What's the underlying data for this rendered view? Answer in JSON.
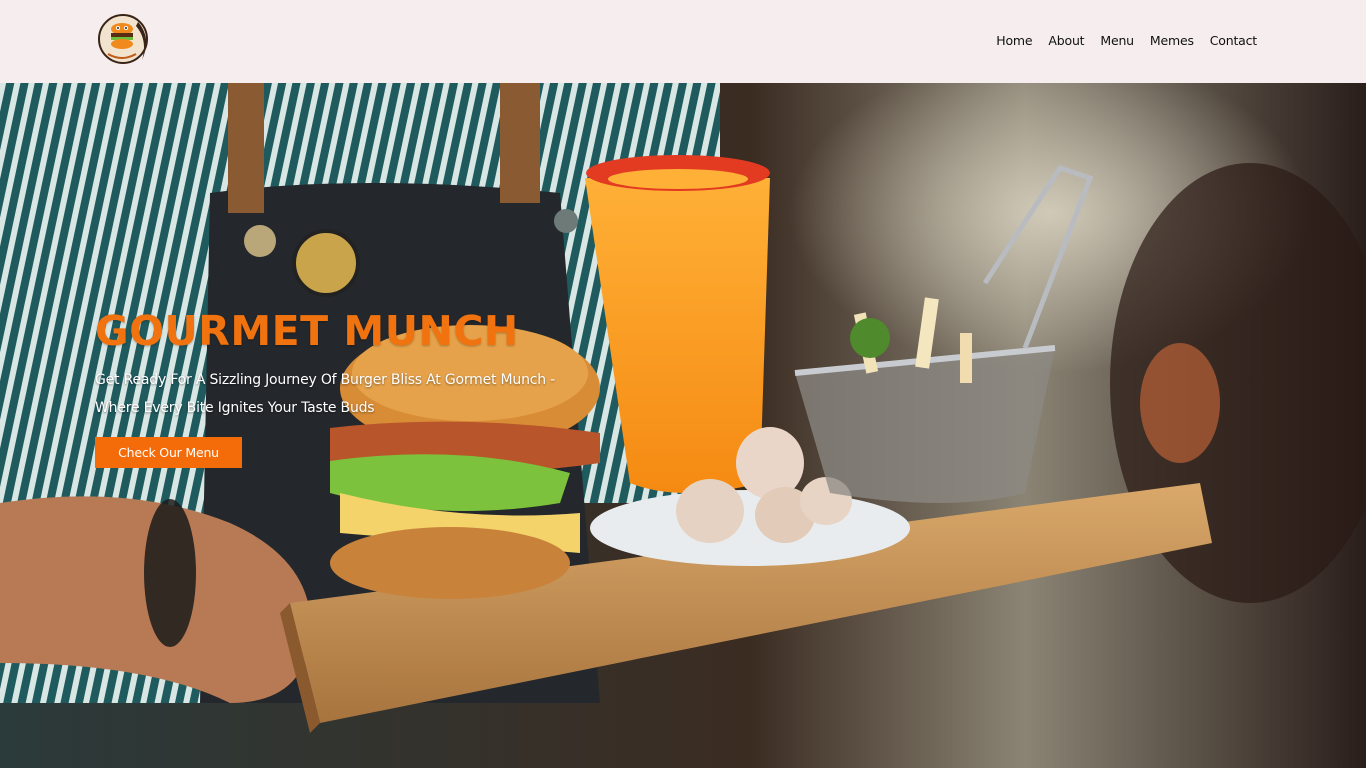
{
  "brand": {
    "logo_icon": "burger-mascot-logo",
    "accent_color": "#f07310",
    "button_color": "#f46b0a",
    "navbar_bg": "#f6eeee"
  },
  "nav": {
    "items": [
      {
        "label": "Home"
      },
      {
        "label": "About"
      },
      {
        "label": "Menu"
      },
      {
        "label": "Memes"
      },
      {
        "label": "Contact"
      }
    ]
  },
  "hero": {
    "title": "GOURMET MUNCH",
    "subtitle": "Get Ready For A Sizzling Journey Of Burger Bliss At Gormet Munch - Where Every Bite Ignites Your Taste Buds",
    "cta_label": "Check Our Menu",
    "image_icon": "burger-tray-photo"
  }
}
